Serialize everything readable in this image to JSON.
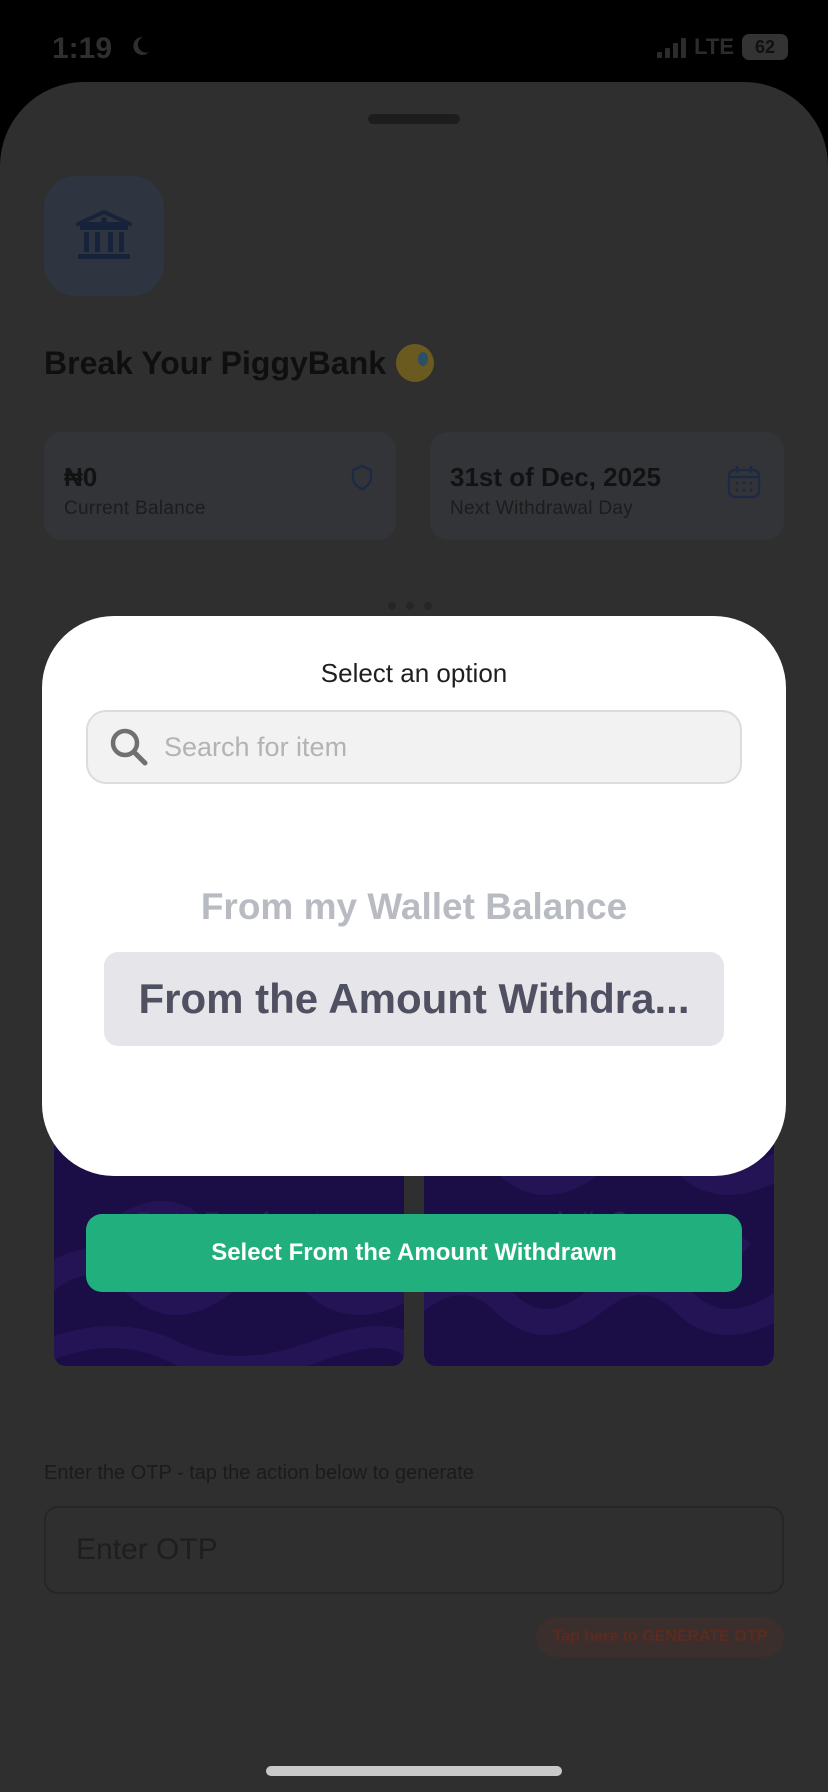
{
  "status_bar": {
    "time": "1:19",
    "network": "LTE",
    "battery": "62"
  },
  "page": {
    "heading": "Break Your PiggyBank"
  },
  "cards": {
    "balance_value": "₦0",
    "balance_label": "Current Balance",
    "date_value": "31st of Dec, 2025",
    "date_label": "Next Withdrawal Day"
  },
  "promos": {
    "left_text": "Faster Transfers ⚡",
    "right_text": "Let's Go"
  },
  "otp": {
    "label": "Enter the OTP - tap the action below to generate",
    "placeholder": "Enter OTP",
    "generate_link": "Tap here to GENERATE OTP"
  },
  "picker": {
    "title": "Select an option",
    "search_placeholder": "Search for item",
    "options": [
      "From my Wallet Balance",
      "From the Amount Withdra..."
    ],
    "selected_index": 1,
    "button_label": "Select From the Amount Withdrawn"
  },
  "colors": {
    "accent_green": "#21b07d",
    "modal_bg": "#ffffff",
    "promo_bg": "#1b0d45",
    "overlay_bg": "#2f2f2f"
  }
}
